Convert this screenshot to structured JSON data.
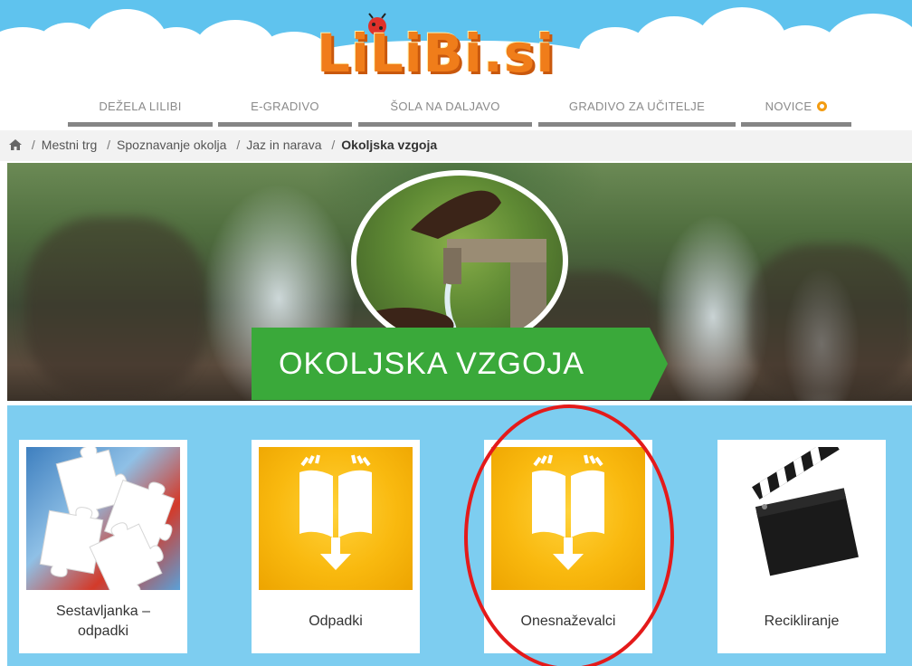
{
  "site": {
    "logo_text": "LiLiBi.si"
  },
  "nav": {
    "items": [
      {
        "label": "DEŽELA LILIBI"
      },
      {
        "label": "E-GRADIVO"
      },
      {
        "label": "ŠOLA NA DALJAVO"
      },
      {
        "label": "GRADIVO ZA UČITELJE"
      },
      {
        "label": "NOVICE"
      }
    ]
  },
  "breadcrumb": {
    "items": [
      "Mestni trg",
      "Spoznavanje okolja",
      "Jaz in narava"
    ],
    "current": "Okoljska vzgoja",
    "separator": "/"
  },
  "hero": {
    "title": "OKOLJSKA VZGOJA"
  },
  "tiles": [
    {
      "label": "Sestavljanka – odpadki",
      "icon": "puzzle-image"
    },
    {
      "label": "Odpadki",
      "icon": "book-download-icon"
    },
    {
      "label": "Onesnaževalci",
      "icon": "book-download-icon"
    },
    {
      "label": "Recikliranje",
      "icon": "clapperboard-icon"
    }
  ],
  "colors": {
    "sky": "#5fc3ee",
    "logo_orange": "#f07d1a",
    "nav_underline": "#858585",
    "banner_green": "#3aa93a",
    "tiles_bg": "#7dcdf0",
    "book_yellow": "#f9b90f",
    "highlight_red": "#e41a1a"
  }
}
